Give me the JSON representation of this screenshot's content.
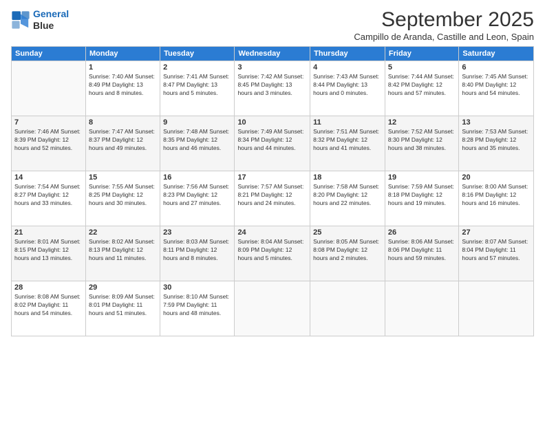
{
  "logo": {
    "line1": "General",
    "line2": "Blue"
  },
  "title": "September 2025",
  "subtitle": "Campillo de Aranda, Castille and Leon, Spain",
  "days_of_week": [
    "Sunday",
    "Monday",
    "Tuesday",
    "Wednesday",
    "Thursday",
    "Friday",
    "Saturday"
  ],
  "weeks": [
    [
      {
        "day": "",
        "info": ""
      },
      {
        "day": "1",
        "info": "Sunrise: 7:40 AM\nSunset: 8:49 PM\nDaylight: 13 hours\nand 8 minutes."
      },
      {
        "day": "2",
        "info": "Sunrise: 7:41 AM\nSunset: 8:47 PM\nDaylight: 13 hours\nand 5 minutes."
      },
      {
        "day": "3",
        "info": "Sunrise: 7:42 AM\nSunset: 8:45 PM\nDaylight: 13 hours\nand 3 minutes."
      },
      {
        "day": "4",
        "info": "Sunrise: 7:43 AM\nSunset: 8:44 PM\nDaylight: 13 hours\nand 0 minutes."
      },
      {
        "day": "5",
        "info": "Sunrise: 7:44 AM\nSunset: 8:42 PM\nDaylight: 12 hours\nand 57 minutes."
      },
      {
        "day": "6",
        "info": "Sunrise: 7:45 AM\nSunset: 8:40 PM\nDaylight: 12 hours\nand 54 minutes."
      }
    ],
    [
      {
        "day": "7",
        "info": "Sunrise: 7:46 AM\nSunset: 8:39 PM\nDaylight: 12 hours\nand 52 minutes."
      },
      {
        "day": "8",
        "info": "Sunrise: 7:47 AM\nSunset: 8:37 PM\nDaylight: 12 hours\nand 49 minutes."
      },
      {
        "day": "9",
        "info": "Sunrise: 7:48 AM\nSunset: 8:35 PM\nDaylight: 12 hours\nand 46 minutes."
      },
      {
        "day": "10",
        "info": "Sunrise: 7:49 AM\nSunset: 8:34 PM\nDaylight: 12 hours\nand 44 minutes."
      },
      {
        "day": "11",
        "info": "Sunrise: 7:51 AM\nSunset: 8:32 PM\nDaylight: 12 hours\nand 41 minutes."
      },
      {
        "day": "12",
        "info": "Sunrise: 7:52 AM\nSunset: 8:30 PM\nDaylight: 12 hours\nand 38 minutes."
      },
      {
        "day": "13",
        "info": "Sunrise: 7:53 AM\nSunset: 8:28 PM\nDaylight: 12 hours\nand 35 minutes."
      }
    ],
    [
      {
        "day": "14",
        "info": "Sunrise: 7:54 AM\nSunset: 8:27 PM\nDaylight: 12 hours\nand 33 minutes."
      },
      {
        "day": "15",
        "info": "Sunrise: 7:55 AM\nSunset: 8:25 PM\nDaylight: 12 hours\nand 30 minutes."
      },
      {
        "day": "16",
        "info": "Sunrise: 7:56 AM\nSunset: 8:23 PM\nDaylight: 12 hours\nand 27 minutes."
      },
      {
        "day": "17",
        "info": "Sunrise: 7:57 AM\nSunset: 8:21 PM\nDaylight: 12 hours\nand 24 minutes."
      },
      {
        "day": "18",
        "info": "Sunrise: 7:58 AM\nSunset: 8:20 PM\nDaylight: 12 hours\nand 22 minutes."
      },
      {
        "day": "19",
        "info": "Sunrise: 7:59 AM\nSunset: 8:18 PM\nDaylight: 12 hours\nand 19 minutes."
      },
      {
        "day": "20",
        "info": "Sunrise: 8:00 AM\nSunset: 8:16 PM\nDaylight: 12 hours\nand 16 minutes."
      }
    ],
    [
      {
        "day": "21",
        "info": "Sunrise: 8:01 AM\nSunset: 8:15 PM\nDaylight: 12 hours\nand 13 minutes."
      },
      {
        "day": "22",
        "info": "Sunrise: 8:02 AM\nSunset: 8:13 PM\nDaylight: 12 hours\nand 11 minutes."
      },
      {
        "day": "23",
        "info": "Sunrise: 8:03 AM\nSunset: 8:11 PM\nDaylight: 12 hours\nand 8 minutes."
      },
      {
        "day": "24",
        "info": "Sunrise: 8:04 AM\nSunset: 8:09 PM\nDaylight: 12 hours\nand 5 minutes."
      },
      {
        "day": "25",
        "info": "Sunrise: 8:05 AM\nSunset: 8:08 PM\nDaylight: 12 hours\nand 2 minutes."
      },
      {
        "day": "26",
        "info": "Sunrise: 8:06 AM\nSunset: 8:06 PM\nDaylight: 11 hours\nand 59 minutes."
      },
      {
        "day": "27",
        "info": "Sunrise: 8:07 AM\nSunset: 8:04 PM\nDaylight: 11 hours\nand 57 minutes."
      }
    ],
    [
      {
        "day": "28",
        "info": "Sunrise: 8:08 AM\nSunset: 8:02 PM\nDaylight: 11 hours\nand 54 minutes."
      },
      {
        "day": "29",
        "info": "Sunrise: 8:09 AM\nSunset: 8:01 PM\nDaylight: 11 hours\nand 51 minutes."
      },
      {
        "day": "30",
        "info": "Sunrise: 8:10 AM\nSunset: 7:59 PM\nDaylight: 11 hours\nand 48 minutes."
      },
      {
        "day": "",
        "info": ""
      },
      {
        "day": "",
        "info": ""
      },
      {
        "day": "",
        "info": ""
      },
      {
        "day": "",
        "info": ""
      }
    ]
  ]
}
